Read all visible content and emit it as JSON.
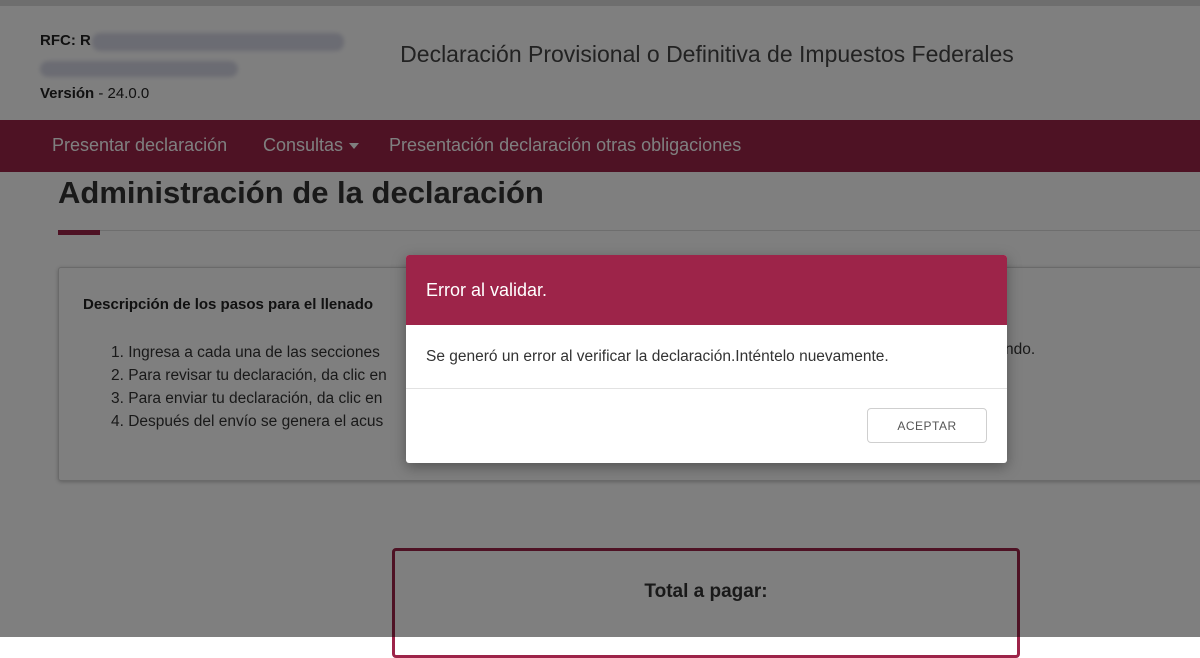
{
  "header": {
    "rfc_label": "RFC:",
    "rfc_value_visible": "R",
    "version_label": "Versión",
    "version_value": "24.0.0",
    "app_title": "Declaración Provisional o Definitiva de Impuestos Federales"
  },
  "navbar": {
    "items": [
      {
        "label": "Presentar declaración"
      },
      {
        "label": "Consultas"
      },
      {
        "label": "Presentación declaración otras obligaciones"
      }
    ]
  },
  "main": {
    "page_title": "Administración de la declaración",
    "steps_heading": "Descripción de los pasos para el llenado",
    "steps": [
      "1. Ingresa a cada una de las secciones",
      "2. Para revisar tu declaración, da clic en",
      "3. Para enviar tu declaración, da clic en",
      "4. Después del envío se genera el acus"
    ],
    "steps_line1_tail": "ndo.",
    "total_label": "Total a pagar:"
  },
  "modal": {
    "title": "Error al validar.",
    "message": "Se generó un error al verificar la declaración.Inténtelo nuevamente.",
    "accept_label": "ACEPTAR"
  },
  "colors": {
    "brand": "#9d2449",
    "overlay": "rgba(0,0,0,0.5)"
  }
}
